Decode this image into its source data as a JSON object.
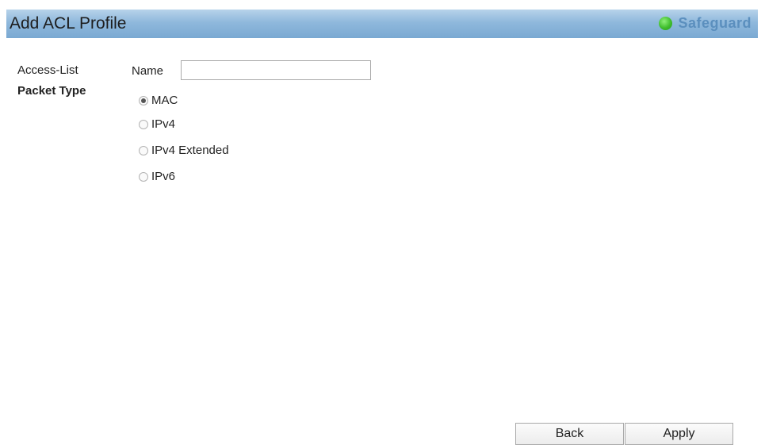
{
  "header": {
    "title": "Add ACL Profile",
    "safeguard_label": "Safeguard",
    "safeguard_color": "#3fbd2c"
  },
  "form": {
    "access_list_label": "Access-List",
    "name_label": "Name",
    "name_value": "",
    "packet_type_label": "Packet Type",
    "packet_types": [
      {
        "label": "MAC",
        "checked": true
      },
      {
        "label": "IPv4",
        "checked": false
      },
      {
        "label": "IPv4 Extended",
        "checked": false
      },
      {
        "label": "IPv6",
        "checked": false
      }
    ]
  },
  "buttons": {
    "back_label": "Back",
    "apply_label": "Apply"
  }
}
